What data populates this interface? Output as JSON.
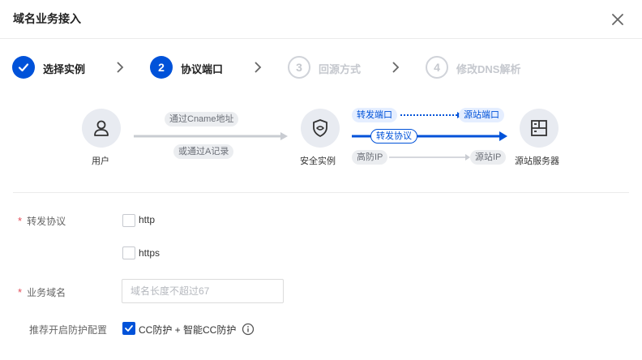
{
  "dialog": {
    "title": "域名业务接入"
  },
  "steps": [
    {
      "number": "1",
      "label": "选择实例",
      "state": "done"
    },
    {
      "number": "2",
      "label": "协议端口",
      "state": "active"
    },
    {
      "number": "3",
      "label": "回源方式",
      "state": "pending"
    },
    {
      "number": "4",
      "label": "修改DNS解析",
      "state": "pending"
    }
  ],
  "diagram": {
    "user_label": "用户",
    "via_cname": "通过Cname地址",
    "via_a_record": "或通过A记录",
    "instance_label": "安全实例",
    "forward_port": "转发端口",
    "origin_port": "源站端口",
    "forward_protocol": "转发协议",
    "high_defense_ip": "高防IP",
    "origin_ip": "源站IP",
    "server_label": "源站服务器",
    "colors": {
      "accent": "#0052d9",
      "node_bg": "#e8ebf1",
      "gray_line": "#c9ccd2"
    }
  },
  "form": {
    "protocol": {
      "label": "转发协议",
      "options": [
        {
          "text": "http",
          "checked": false
        },
        {
          "text": "https",
          "checked": false
        }
      ]
    },
    "domain": {
      "label": "业务域名",
      "placeholder": "域名长度不超过67",
      "value": ""
    },
    "recommend": {
      "label": "推荐开启防护配置",
      "option_text": "CC防护 + 智能CC防护",
      "checked": true
    }
  }
}
